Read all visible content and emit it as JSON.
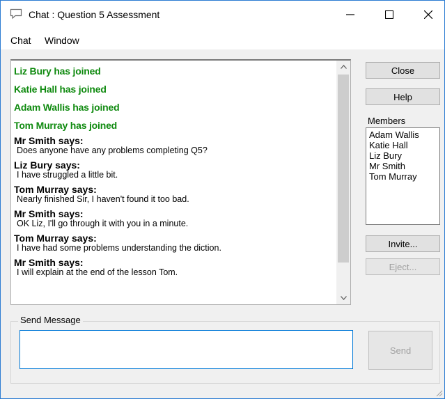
{
  "window": {
    "title": "Chat : Question 5 Assessment"
  },
  "menu": [
    "Chat",
    "Window"
  ],
  "log": {
    "joins": [
      "Liz Bury has joined",
      "Katie Hall has joined",
      "Adam Wallis has joined",
      "Tom Murray has joined"
    ],
    "messages": [
      {
        "name": "Mr Smith says:",
        "text": "Does anyone have any problems completing Q5?"
      },
      {
        "name": "Liz Bury says:",
        "text": "I have struggled a little bit."
      },
      {
        "name": "Tom Murray says:",
        "text": "Nearly finished Sir, I haven't found it too bad."
      },
      {
        "name": "Mr Smith says:",
        "text": "OK Liz, I'll go through it with you in a minute."
      },
      {
        "name": "Tom Murray says:",
        "text": "I have had some problems understanding the diction."
      },
      {
        "name": "Mr Smith says:",
        "text": "I will explain at the end of the lesson Tom."
      }
    ]
  },
  "buttons": {
    "close": "Close",
    "help": "Help",
    "invite": "Invite...",
    "eject": "Eject...",
    "send": "Send"
  },
  "members": {
    "label": "Members",
    "items": [
      "Adam Wallis",
      "Katie Hall",
      "Liz Bury",
      "Mr Smith",
      "Tom Murray"
    ]
  },
  "send_group": {
    "label": "Send Message",
    "value": ""
  },
  "colors": {
    "join_text": "#0f8a0f",
    "focus_border": "#0078d7"
  }
}
